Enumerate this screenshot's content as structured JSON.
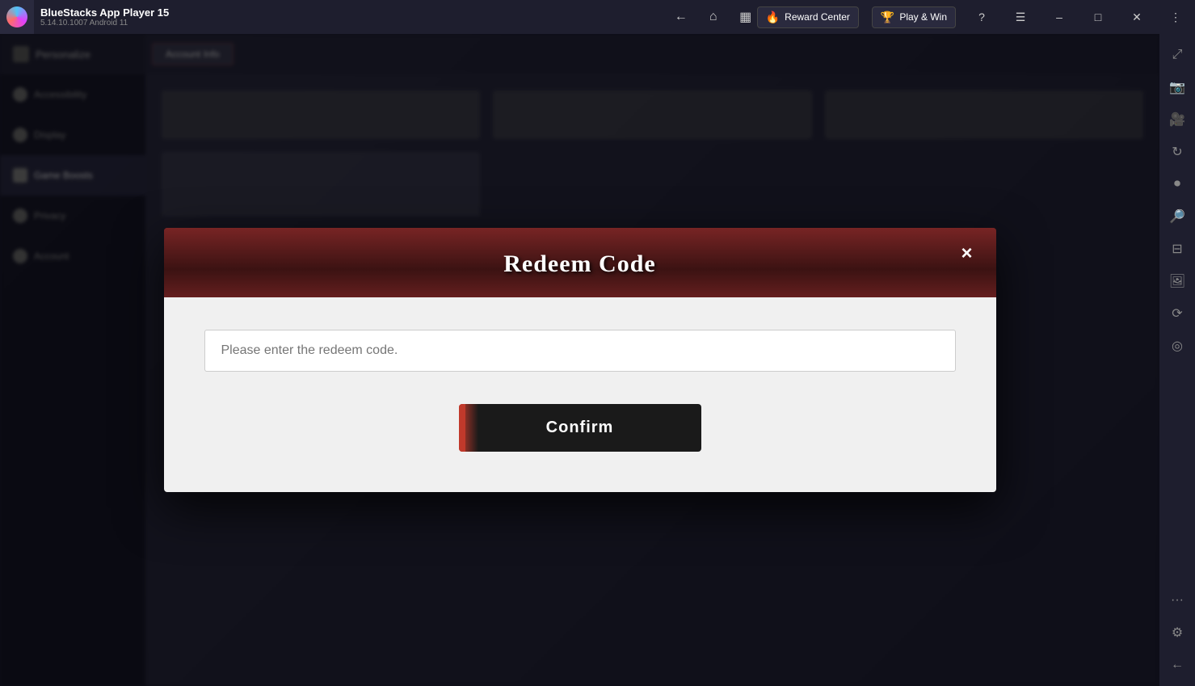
{
  "titleBar": {
    "appName": "BlueStacks App Player 15",
    "version": "5.14.10.1007  Android 11",
    "rewardCenter": "Reward Center",
    "playAndWin": "Play & Win"
  },
  "modal": {
    "title": "Redeem Code",
    "closeLabel": "×",
    "inputPlaceholder": "Please enter the redeem code.",
    "confirmLabel": "Confirm"
  },
  "rightSidebar": {
    "icons": [
      {
        "name": "expand-icon",
        "symbol": "⤢"
      },
      {
        "name": "screenshot-icon",
        "symbol": "📷"
      },
      {
        "name": "camera-icon",
        "symbol": "🎥"
      },
      {
        "name": "sync-icon",
        "symbol": "↻"
      },
      {
        "name": "record-icon",
        "symbol": "⏺"
      },
      {
        "name": "zoom-in-icon",
        "symbol": "🔍"
      },
      {
        "name": "zoom-out-icon",
        "symbol": "⊟"
      },
      {
        "name": "screenshot2-icon",
        "symbol": "🖼"
      },
      {
        "name": "rotate-icon",
        "symbol": "⟳"
      },
      {
        "name": "location-icon",
        "symbol": "◎"
      },
      {
        "name": "more-icon",
        "symbol": "···"
      },
      {
        "name": "settings-icon",
        "symbol": "⚙"
      },
      {
        "name": "arrow-icon",
        "symbol": "←"
      }
    ]
  }
}
